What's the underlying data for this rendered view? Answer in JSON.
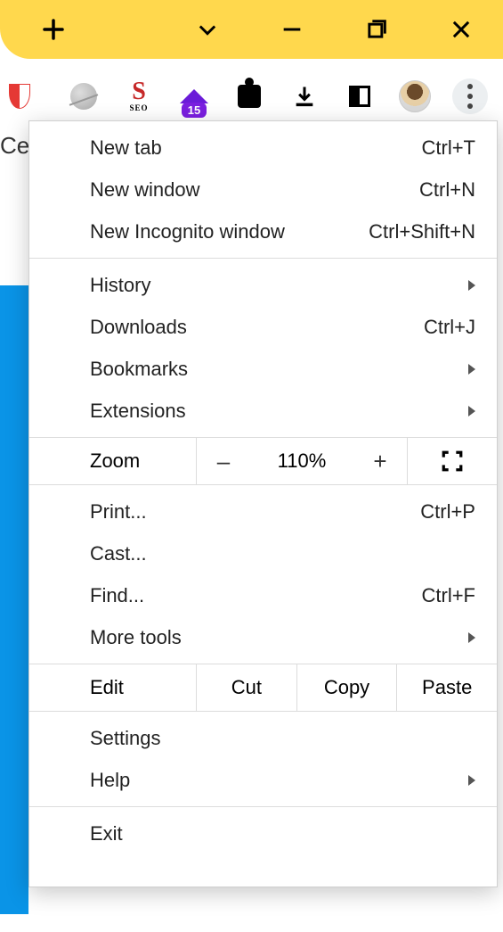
{
  "page_fragment": "Ce",
  "toolbar": {
    "purple_badge": "15"
  },
  "menu": {
    "section1": [
      {
        "label": "New tab",
        "shortcut": "Ctrl+T"
      },
      {
        "label": "New window",
        "shortcut": "Ctrl+N"
      },
      {
        "label": "New Incognito window",
        "shortcut": "Ctrl+Shift+N"
      }
    ],
    "section2": [
      {
        "label": "History",
        "submenu": true
      },
      {
        "label": "Downloads",
        "shortcut": "Ctrl+J"
      },
      {
        "label": "Bookmarks",
        "submenu": true
      },
      {
        "label": "Extensions",
        "submenu": true
      }
    ],
    "zoom": {
      "label": "Zoom",
      "minus": "–",
      "value": "110%",
      "plus": "+"
    },
    "section3": [
      {
        "label": "Print...",
        "shortcut": "Ctrl+P"
      },
      {
        "label": "Cast..."
      },
      {
        "label": "Find...",
        "shortcut": "Ctrl+F"
      },
      {
        "label": "More tools",
        "submenu": true
      }
    ],
    "edit": {
      "label": "Edit",
      "cut": "Cut",
      "copy": "Copy",
      "paste": "Paste"
    },
    "section4": [
      {
        "label": "Settings"
      },
      {
        "label": "Help",
        "submenu": true
      }
    ],
    "section5": [
      {
        "label": "Exit"
      }
    ]
  }
}
